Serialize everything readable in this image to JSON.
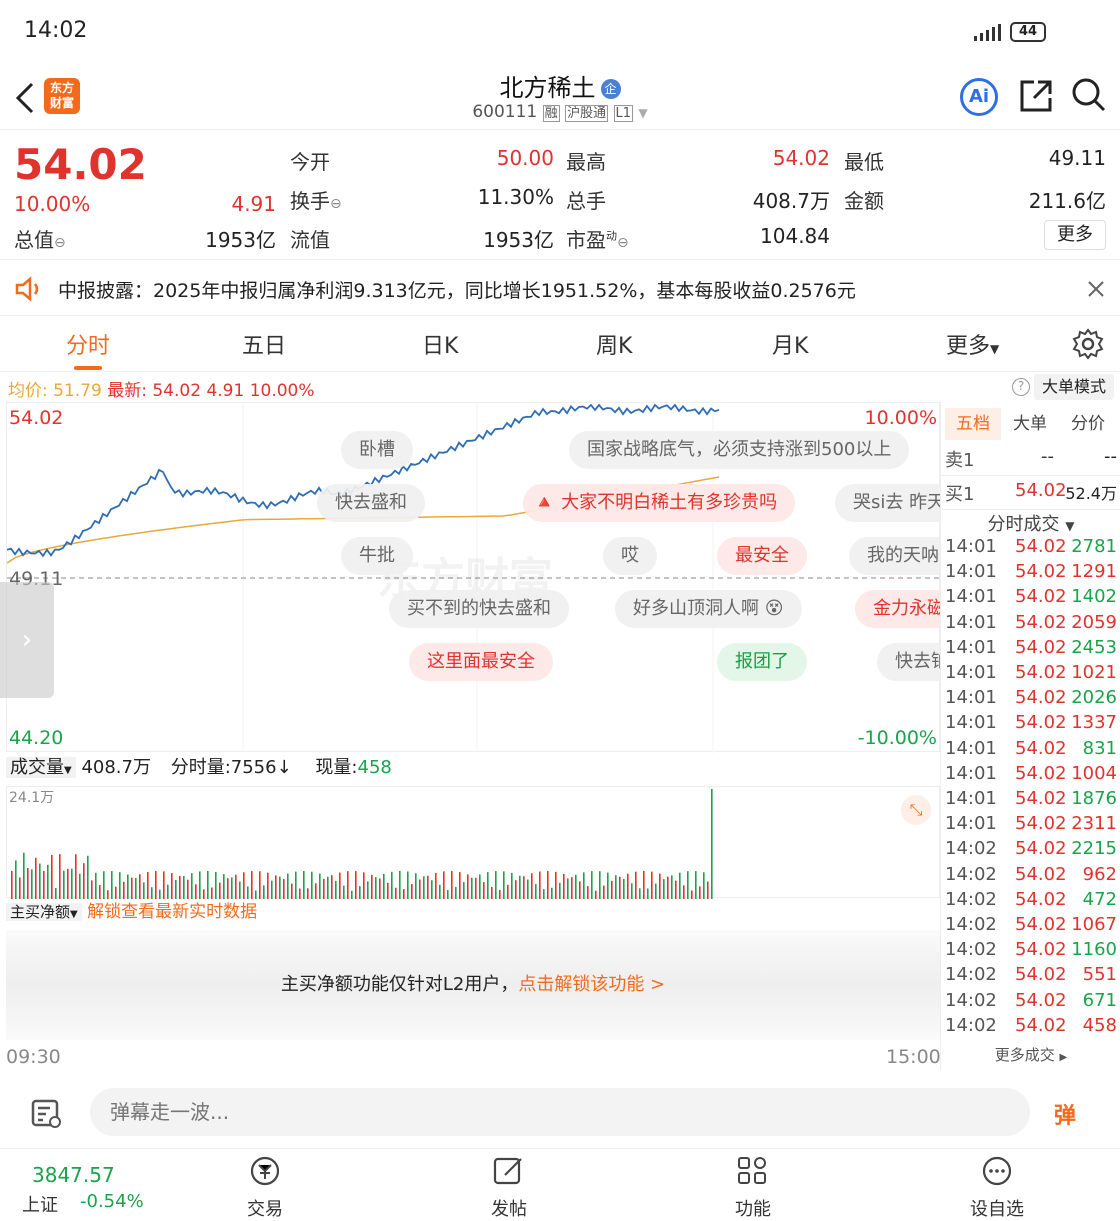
{
  "status": {
    "time": "14:02",
    "battery": "44"
  },
  "header": {
    "title": "北方稀土",
    "badge": "企",
    "code": "600111",
    "tag_rong": "融",
    "tag_hgt": "沪股通",
    "tag_l1": "L1",
    "logo_line1": "东方",
    "logo_line2": "财富",
    "ai_label": "Ai"
  },
  "quote": {
    "price": "54.02",
    "change_pct": "10.00%",
    "change": "4.91",
    "total_value_label": "总值",
    "total_value": "1953亿",
    "open_label": "今开",
    "open": "50.00",
    "high_label": "最高",
    "high": "54.02",
    "low_label": "最低",
    "low": "49.11",
    "turnover_label": "换手",
    "turnover": "11.30%",
    "volume_label": "总手",
    "volume": "408.7万",
    "amount_label": "金额",
    "amount": "211.6亿",
    "float_label": "流值",
    "float": "1953亿",
    "pe_label": "市盈",
    "pe_sup": "动",
    "pe": "104.84",
    "more": "更多"
  },
  "notice": {
    "text": "中报披露：2025年中报归属净利润9.313亿元，同比增长1951.52%，基本每股收益0.2576元"
  },
  "tabs": [
    "分时",
    "五日",
    "日K",
    "周K",
    "月K",
    "更多"
  ],
  "chart_info": {
    "avg_label": "均价:",
    "avg": "51.79",
    "latest_label": "最新:",
    "latest": "54.02",
    "chg": "4.91",
    "pct": "10.00%",
    "big_order_mode": "大单模式"
  },
  "price_axis": {
    "top": "54.02",
    "mid": "49.11",
    "bottom": "44.20",
    "top_pct": "10.00%",
    "bottom_pct": "-10.00%"
  },
  "watermark": "东方财富",
  "danmaku": [
    {
      "text": "卧槽",
      "style": "gray"
    },
    {
      "text": "国家战略底气，必须支持涨到500以上",
      "style": "gray"
    },
    {
      "text": "快去盛和",
      "style": "gray"
    },
    {
      "text": "大家不明白稀土有多珍贵吗",
      "style": "red"
    },
    {
      "text": "哭si去 昨天",
      "style": "gray"
    },
    {
      "text": "牛批",
      "style": "gray"
    },
    {
      "text": "哎",
      "style": "gray"
    },
    {
      "text": "最安全",
      "style": "red"
    },
    {
      "text": "我的天呐",
      "style": "gray"
    },
    {
      "text": "买不到的快去盛和",
      "style": "gray"
    },
    {
      "text": "好多山顶洞人啊",
      "style": "gray"
    },
    {
      "text": "金力永磁",
      "style": "red"
    },
    {
      "text": "这里面最安全",
      "style": "red"
    },
    {
      "text": "报团了",
      "style": "green"
    },
    {
      "text": "快去铂",
      "style": "gray"
    }
  ],
  "volume_bar": {
    "label": "成交量",
    "total": "408.7万",
    "minute_label": "分时量:",
    "minute": "7556",
    "now_label": "现量:",
    "now": "458",
    "max": "24.1万"
  },
  "net_buy": {
    "label": "主买净额",
    "unlock": "解锁查看最新实时数据",
    "msg": "主买净额功能仅针对L2用户，",
    "link": "点击解锁该功能 >"
  },
  "time_axis": {
    "start": "09:30",
    "end": "15:00"
  },
  "right_panel": {
    "tabs": [
      "五档",
      "大单",
      "分价"
    ],
    "sell1_label": "卖1",
    "sell1_price": "--",
    "sell1_vol": "--",
    "buy1_label": "买1",
    "buy1_price": "54.02",
    "buy1_vol": "52.4万",
    "trades_label": "分时成交",
    "trades": [
      {
        "t": "14:01",
        "p": "54.02",
        "v": "2781",
        "c": "green"
      },
      {
        "t": "14:01",
        "p": "54.02",
        "v": "1291",
        "c": "red"
      },
      {
        "t": "14:01",
        "p": "54.02",
        "v": "1402",
        "c": "green"
      },
      {
        "t": "14:01",
        "p": "54.02",
        "v": "2059",
        "c": "red"
      },
      {
        "t": "14:01",
        "p": "54.02",
        "v": "2453",
        "c": "green"
      },
      {
        "t": "14:01",
        "p": "54.02",
        "v": "1021",
        "c": "red"
      },
      {
        "t": "14:01",
        "p": "54.02",
        "v": "2026",
        "c": "green"
      },
      {
        "t": "14:01",
        "p": "54.02",
        "v": "1337",
        "c": "red"
      },
      {
        "t": "14:01",
        "p": "54.02",
        "v": "831",
        "c": "green"
      },
      {
        "t": "14:01",
        "p": "54.02",
        "v": "1004",
        "c": "red"
      },
      {
        "t": "14:01",
        "p": "54.02",
        "v": "1876",
        "c": "green"
      },
      {
        "t": "14:01",
        "p": "54.02",
        "v": "2311",
        "c": "red"
      },
      {
        "t": "14:02",
        "p": "54.02",
        "v": "2215",
        "c": "green"
      },
      {
        "t": "14:02",
        "p": "54.02",
        "v": "962",
        "c": "red"
      },
      {
        "t": "14:02",
        "p": "54.02",
        "v": "472",
        "c": "green"
      },
      {
        "t": "14:02",
        "p": "54.02",
        "v": "1067",
        "c": "red"
      },
      {
        "t": "14:02",
        "p": "54.02",
        "v": "1160",
        "c": "green"
      },
      {
        "t": "14:02",
        "p": "54.02",
        "v": "551",
        "c": "red"
      },
      {
        "t": "14:02",
        "p": "54.02",
        "v": "671",
        "c": "green"
      },
      {
        "t": "14:02",
        "p": "54.02",
        "v": "458",
        "c": "red"
      }
    ],
    "more_trades": "更多成交"
  },
  "input": {
    "placeholder": "弹幕走一波...",
    "danmu_btn": "弹"
  },
  "nav": {
    "index_value": "3847.57",
    "index_name": "上证",
    "index_pct": "-0.54%",
    "items": [
      "交易",
      "发帖",
      "功能",
      "设自选"
    ]
  },
  "colors": {
    "up": "#e0332d",
    "down": "#1aa34a",
    "price_line": "#2f6db3",
    "avg_line": "#e8a93a",
    "accent": "#f26b1d"
  }
}
